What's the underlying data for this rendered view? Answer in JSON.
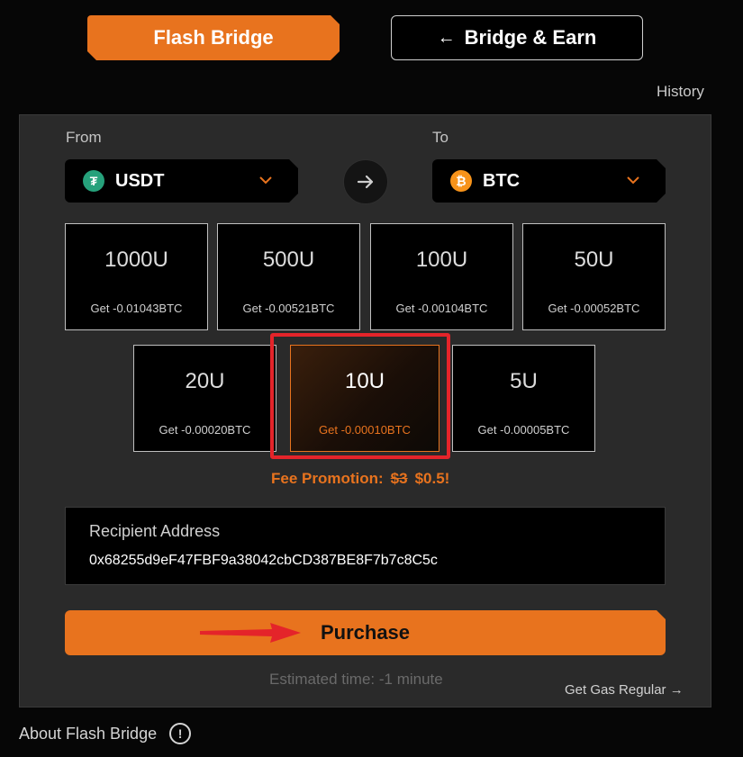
{
  "tabs": {
    "flash_bridge": "Flash Bridge",
    "bridge_earn": "Bridge & Earn",
    "bridge_earn_arrow": "←"
  },
  "history_label": "History",
  "from": {
    "label": "From",
    "token": "USDT",
    "icon": "tether-icon",
    "icon_glyph": "₮",
    "icon_color": "#26a17b"
  },
  "to": {
    "label": "To",
    "token": "BTC",
    "icon": "bitcoin-icon",
    "icon_glyph": "₿",
    "icon_color": "#f7931a"
  },
  "amounts": [
    {
      "amount": "1000U",
      "get": "Get -0.01043BTC"
    },
    {
      "amount": "500U",
      "get": "Get -0.00521BTC"
    },
    {
      "amount": "100U",
      "get": "Get -0.00104BTC"
    },
    {
      "amount": "50U",
      "get": "Get -0.00052BTC"
    },
    {
      "amount": "20U",
      "get": "Get -0.00020BTC"
    },
    {
      "amount": "10U",
      "get": "Get -0.00010BTC",
      "selected": true
    },
    {
      "amount": "5U",
      "get": "Get -0.00005BTC"
    }
  ],
  "fee": {
    "label": "Fee Promotion:",
    "old_price": "$3",
    "new_price": "$0.5!"
  },
  "recipient": {
    "label": "Recipient Address",
    "address": "0x68255d9eF47FBF9a38042cbCD387BE8F7b7c8C5c"
  },
  "purchase_label": "Purchase",
  "estimated_time": "Estimated time: -1 minute",
  "gas_link": "Get Gas Regular →",
  "about": {
    "label": "About Flash Bridge",
    "icon_glyph": "!"
  },
  "colors": {
    "accent": "#e8731e",
    "highlight": "#e4242a"
  }
}
